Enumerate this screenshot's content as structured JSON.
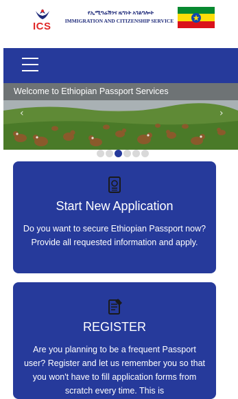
{
  "header": {
    "ics_label": "ICS",
    "org_amharic": "የኢሚግሬሽንና ዜግነት አገልግሎት",
    "org_english": "IMMIGRATION AND  CITIZENSHIP SERVICE"
  },
  "nav": {
    "menu_icon": "hamburger-menu-icon"
  },
  "banner": {
    "caption": "Welcome to Ethiopian Passport Services",
    "prev_arrow": "‹",
    "next_arrow": "›",
    "slide_count": 6,
    "active_slide": 3
  },
  "cards": [
    {
      "icon": "passport-icon",
      "title": "Start New Application",
      "description": "Do you want to secure Ethiopian Passport now? Provide all requested information and apply."
    },
    {
      "icon": "register-document-icon",
      "title": "REGISTER",
      "description": "Are you planning to be a frequent Passport user? Register and let us remember you so that you won't have to fill application forms from scratch every time. This is"
    }
  ],
  "colors": {
    "primary": "#263a9b",
    "accent_red": "#e02828",
    "dot_inactive": "#d9d9d9"
  }
}
